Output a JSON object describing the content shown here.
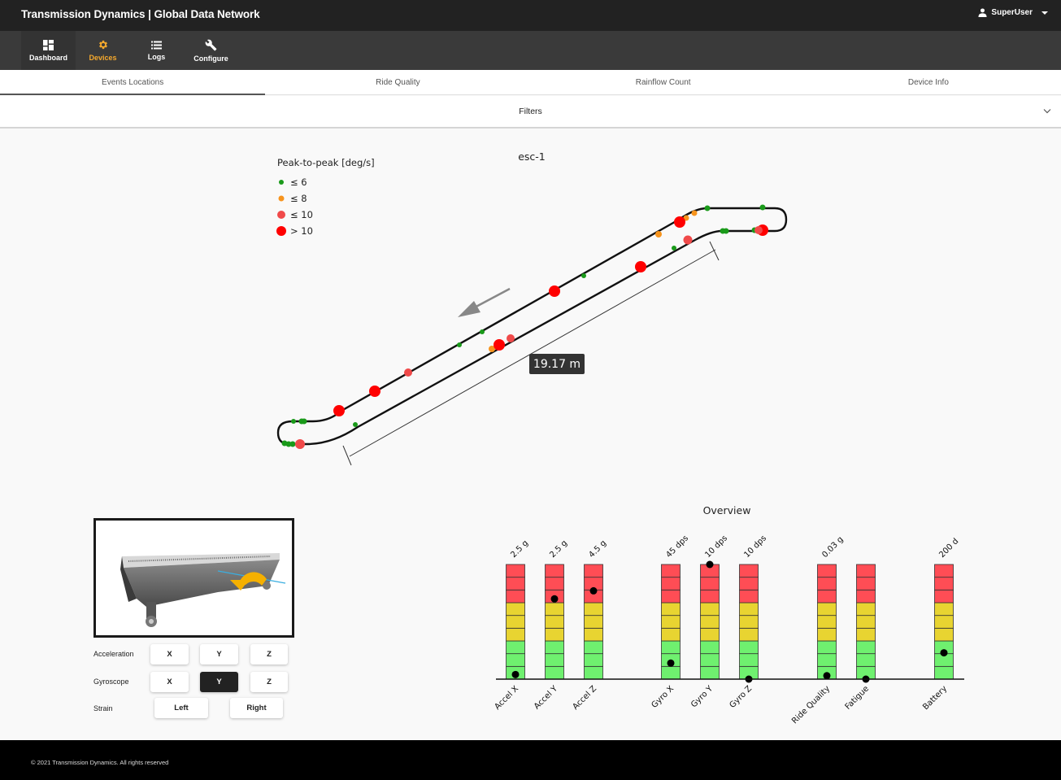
{
  "app": {
    "title": "Transmission Dynamics | Global Data Network",
    "user": "SuperUser",
    "user_icon": "person-icon"
  },
  "nav": [
    {
      "label": "Dashboard",
      "icon": "dashboard-icon",
      "active": false
    },
    {
      "label": "Devices",
      "icon": "gear-icon",
      "active": true
    },
    {
      "label": "Logs",
      "icon": "list-icon",
      "active": false
    },
    {
      "label": "Configure",
      "icon": "wrench-icon",
      "active": false
    }
  ],
  "tabs": [
    {
      "label": "Events Locations",
      "active": true
    },
    {
      "label": "Ride Quality",
      "active": false
    },
    {
      "label": "Rainflow Count",
      "active": false
    },
    {
      "label": "Device Info",
      "active": false
    }
  ],
  "filters": {
    "label": "Filters"
  },
  "map": {
    "title": "esc-1",
    "legend_title": "Peak-to-peak [deg/s]",
    "legend": [
      {
        "label": "≤ 6",
        "color": "#1a9a1a"
      },
      {
        "label": "≤ 8",
        "color": "#f7941d"
      },
      {
        "label": "≤ 10",
        "color": "#f04a4a"
      },
      {
        "label": "> 10",
        "color": "#ff0000"
      }
    ],
    "distance_label": "19.17 m",
    "direction": "down-left"
  },
  "controls": {
    "acceleration": {
      "label": "Acceleration",
      "options": [
        "X",
        "Y",
        "Z"
      ],
      "selected": null
    },
    "gyroscope": {
      "label": "Gyroscope",
      "options": [
        "X",
        "Y",
        "Z"
      ],
      "selected": "Y"
    },
    "strain": {
      "label": "Strain",
      "options": [
        "Left",
        "Right"
      ],
      "selected": null
    }
  },
  "overview": {
    "title": "Overview",
    "colors": {
      "green": "#6ff06f",
      "yellow": "#e8d431",
      "red": "#ff4d55"
    },
    "gauges": [
      {
        "name": "Accel X",
        "max_label": "2.5 g",
        "level": 0.04
      },
      {
        "name": "Accel Y",
        "max_label": "2.5 g",
        "level": 0.7
      },
      {
        "name": "Accel Z",
        "max_label": "4.5 g",
        "level": 0.77
      },
      {
        "name": "Gyro X",
        "max_label": "45 dps",
        "level": 0.14
      },
      {
        "name": "Gyro Y",
        "max_label": "10 dps",
        "level": 1.0
      },
      {
        "name": "Gyro Z",
        "max_label": "10 dps",
        "level": 0.0
      },
      {
        "name": "Ride Quality",
        "max_label": "0.03 g",
        "level": 0.03
      },
      {
        "name": "Fatigue",
        "max_label": "",
        "level": 0.0
      },
      {
        "name": "Battery",
        "max_label": "200 d",
        "level": 0.23
      }
    ]
  },
  "footer": {
    "text": "© 2021 Transmission Dynamics. All rights reserved"
  }
}
